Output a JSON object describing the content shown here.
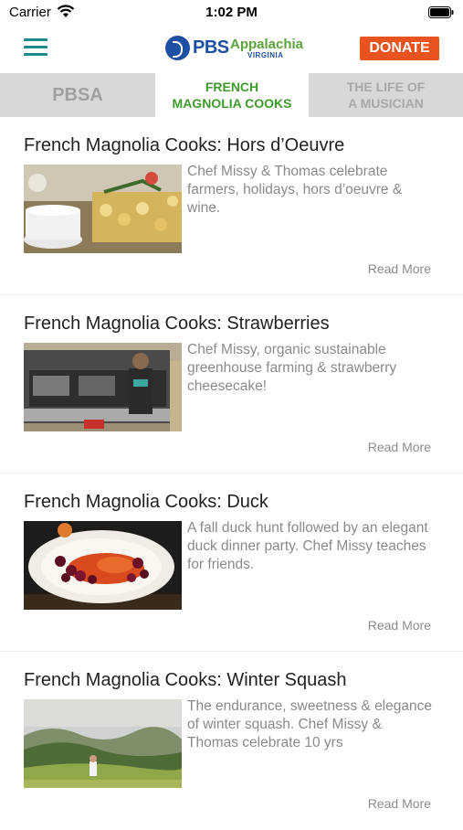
{
  "status_bar": {
    "carrier": "Carrier",
    "time": "1:02 PM",
    "icons": [
      "wifi-icon",
      "battery-icon"
    ]
  },
  "header": {
    "logo_pbs": "PBS",
    "logo_appalachia": "Appalachia",
    "logo_virginia": "VIRGINIA",
    "donate_label": "DONATE",
    "accent_color": "#1b8a8c",
    "donate_color": "#e8531f",
    "brand_blue": "#1d4fa3",
    "brand_green": "#5ba33a"
  },
  "tabs": [
    {
      "label": "PBSA",
      "active": false
    },
    {
      "label_line1": "FRENCH",
      "label_line2": "MAGNOLIA COOKS",
      "active": true
    },
    {
      "label_line1": "THE LIFE OF",
      "label_line2": "A MUSICIAN",
      "active": false
    }
  ],
  "articles": [
    {
      "title": "French Magnolia Cooks: Hors d’Oeuvre",
      "description": "Chef Missy & Thomas celebrate farmers, holidays, hors d’oeuvre & wine.",
      "read_more": "Read More"
    },
    {
      "title": "French Magnolia Cooks: Strawberries",
      "description": "Chef Missy, organic sustainable greenhouse farming & strawberry cheesecake!",
      "read_more": "Read More"
    },
    {
      "title": "French Magnolia Cooks: Duck",
      "description": "A fall duck hunt followed by an elegant duck dinner party. Chef Missy teaches for friends.",
      "read_more": "Read More"
    },
    {
      "title": "French Magnolia Cooks: Winter Squash",
      "description": "The endurance, sweetness & elegance of winter squash. Chef Missy & Thomas celebrate 10 yrs",
      "read_more": "Read More"
    }
  ]
}
